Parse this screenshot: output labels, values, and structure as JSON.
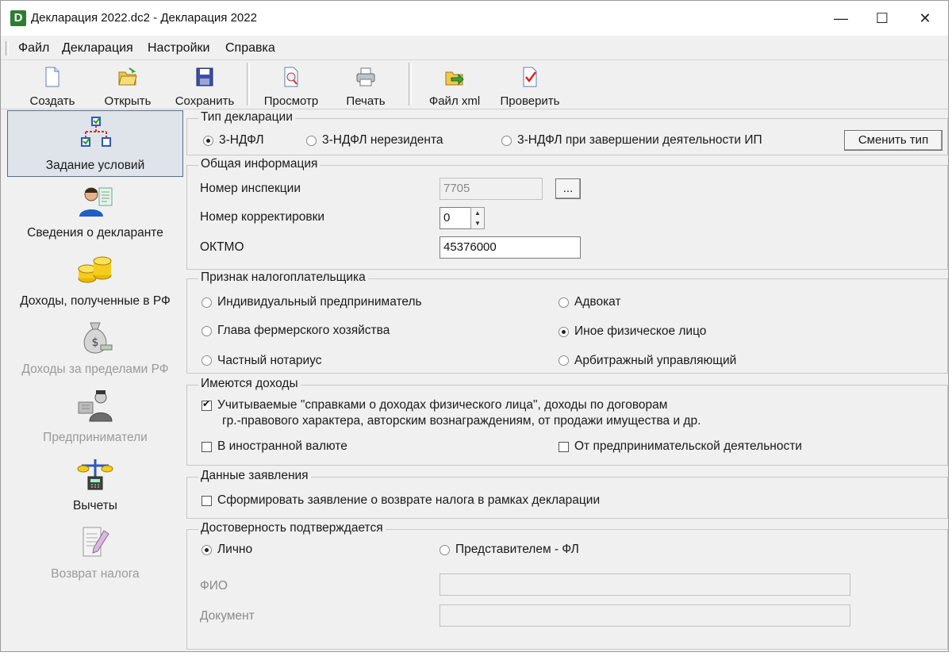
{
  "window": {
    "title": "Декларация 2022.dc2 - Декларация 2022",
    "app_icon_letter": "D",
    "minimize": "—",
    "maximize": "☐",
    "close": "✕"
  },
  "menu": [
    "Файл",
    "Декларация",
    "Настройки",
    "Справка"
  ],
  "toolbar": {
    "create": "Создать",
    "open": "Открыть",
    "save": "Сохранить",
    "preview": "Просмотр",
    "print": "Печать",
    "xml": "Файл xml",
    "check": "Проверить"
  },
  "nav": [
    {
      "label": "Задание условий",
      "icon": "conditions-icon",
      "active": true
    },
    {
      "label": "Сведения о декларанте",
      "icon": "declarant-icon"
    },
    {
      "label": "Доходы, полученные в РФ",
      "icon": "coins-icon"
    },
    {
      "label": "Доходы за пределами РФ",
      "icon": "money-bag-icon",
      "disabled": true
    },
    {
      "label": "Предприниматели",
      "icon": "businessman-icon",
      "disabled": true
    },
    {
      "label": "Вычеты",
      "icon": "scales-icon"
    },
    {
      "label": "Возврат налога",
      "icon": "document-pen-icon",
      "disabled": true
    }
  ],
  "decl_type": {
    "title": "Тип декларации",
    "options": [
      "3-НДФЛ",
      "3-НДФЛ нерезидента",
      "3-НДФЛ при завершении деятельности ИП"
    ],
    "selected": "3-НДФЛ",
    "change_button": "Сменить тип"
  },
  "general": {
    "title": "Общая информация",
    "inspection_label": "Номер инспекции",
    "inspection_value": "7705",
    "browse_button": "...",
    "correction_label": "Номер корректировки",
    "correction_value": "0",
    "oktmo_label": "ОКТМО",
    "oktmo_value": "45376000"
  },
  "taxpayer": {
    "title": "Признак налогоплательщика",
    "options": [
      "Индивидуальный предприниматель",
      "Адвокат",
      "Глава фермерского хозяйства",
      "Иное физическое лицо",
      "Частный нотариус",
      "Арбитражный управляющий"
    ],
    "selected": "Иное физическое лицо"
  },
  "income": {
    "title": "Имеются доходы",
    "certificates_line1": "Учитываемые \"справками о доходах физического лица\", доходы по договорам",
    "certificates_line2": "гр.-правового характера, авторским вознаграждениям, от продажи имущества и др.",
    "foreign_currency": "В иностранной валюте",
    "business": "От предпринимательской деятельности"
  },
  "application": {
    "title": "Данные заявления",
    "refund": "Сформировать заявление о возврате налога в рамках декларации"
  },
  "confirm": {
    "title": "Достоверность подтверждается",
    "personal": "Лично",
    "representative": "Представителем - ФЛ",
    "selected": "Лично",
    "fio_label": "ФИО",
    "doc_label": "Документ"
  }
}
